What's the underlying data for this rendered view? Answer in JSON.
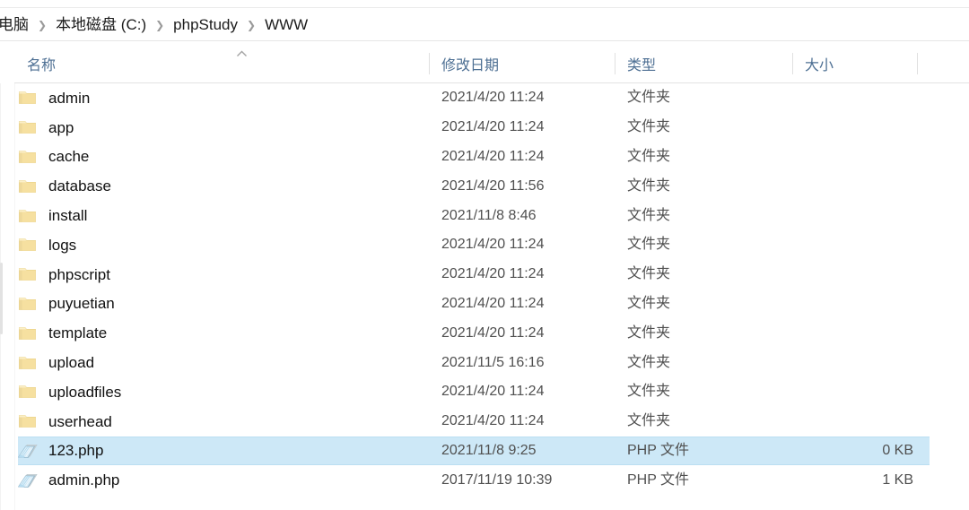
{
  "window": {
    "app": "File Explorer",
    "breadcrumb": {
      "separator": "❯",
      "items": [
        {
          "label": "电脑"
        },
        {
          "label": "本地磁盘 (C:)"
        },
        {
          "label": "phpStudy"
        },
        {
          "label": "WWW"
        }
      ]
    }
  },
  "columns": {
    "sort": {
      "column": "名称",
      "direction": "ascending",
      "glyph": "caret-up"
    },
    "headers": [
      {
        "key": "name",
        "label": "名称"
      },
      {
        "key": "date",
        "label": "修改日期"
      },
      {
        "key": "type",
        "label": "类型"
      },
      {
        "key": "size",
        "label": "大小"
      }
    ]
  },
  "colors": {
    "selection": "#cde8f7",
    "selection_border": "#bcdff2",
    "header_text": "#4d6f93",
    "folder_icon": "#f5dd9a",
    "doc_icon": "#bcdff0"
  },
  "files": [
    {
      "name": "admin",
      "date": "2021/4/20 11:24",
      "type": "文件夹",
      "size": "",
      "icon": "folder-icon",
      "selected": false
    },
    {
      "name": "app",
      "date": "2021/4/20 11:24",
      "type": "文件夹",
      "size": "",
      "icon": "folder-icon",
      "selected": false
    },
    {
      "name": "cache",
      "date": "2021/4/20 11:24",
      "type": "文件夹",
      "size": "",
      "icon": "folder-icon",
      "selected": false
    },
    {
      "name": "database",
      "date": "2021/4/20 11:56",
      "type": "文件夹",
      "size": "",
      "icon": "folder-icon",
      "selected": false
    },
    {
      "name": "install",
      "date": "2021/11/8 8:46",
      "type": "文件夹",
      "size": "",
      "icon": "folder-icon",
      "selected": false
    },
    {
      "name": "logs",
      "date": "2021/4/20 11:24",
      "type": "文件夹",
      "size": "",
      "icon": "folder-icon",
      "selected": false
    },
    {
      "name": "phpscript",
      "date": "2021/4/20 11:24",
      "type": "文件夹",
      "size": "",
      "icon": "folder-icon",
      "selected": false
    },
    {
      "name": "puyuetian",
      "date": "2021/4/20 11:24",
      "type": "文件夹",
      "size": "",
      "icon": "folder-icon",
      "selected": false
    },
    {
      "name": "template",
      "date": "2021/4/20 11:24",
      "type": "文件夹",
      "size": "",
      "icon": "folder-icon",
      "selected": false
    },
    {
      "name": "upload",
      "date": "2021/11/5 16:16",
      "type": "文件夹",
      "size": "",
      "icon": "folder-icon",
      "selected": false
    },
    {
      "name": "uploadfiles",
      "date": "2021/4/20 11:24",
      "type": "文件夹",
      "size": "",
      "icon": "folder-icon",
      "selected": false
    },
    {
      "name": "userhead",
      "date": "2021/4/20 11:24",
      "type": "文件夹",
      "size": "",
      "icon": "folder-icon",
      "selected": false
    },
    {
      "name": "123.php",
      "date": "2021/11/8 9:25",
      "type": "PHP 文件",
      "size": "0 KB",
      "icon": "php-file-icon",
      "selected": true
    },
    {
      "name": "admin.php",
      "date": "2017/11/19 10:39",
      "type": "PHP 文件",
      "size": "1 KB",
      "icon": "php-file-icon",
      "selected": false
    }
  ]
}
